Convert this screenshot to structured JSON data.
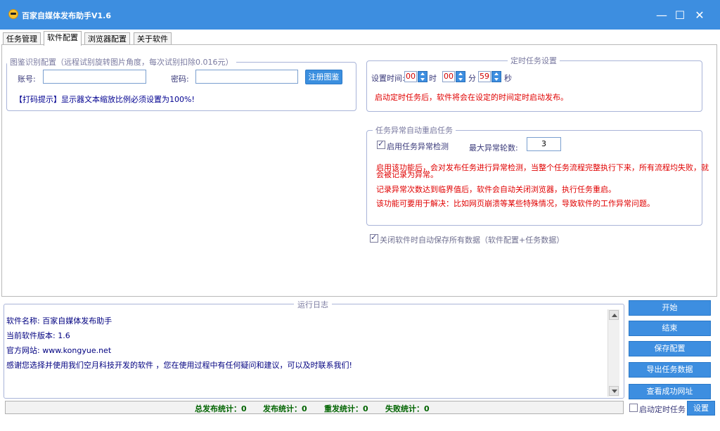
{
  "window": {
    "title": "百家自媒体发布助手V1.6",
    "minimize_icon": "minimize-icon",
    "maximize_icon": "maximize-icon",
    "close_icon": "close-icon",
    "minimize_glyph": "—",
    "maximize_glyph": "☐",
    "close_glyph": "✕"
  },
  "tabs": [
    {
      "label": "任务管理",
      "active": false
    },
    {
      "label": "软件配置",
      "active": true
    },
    {
      "label": "浏览器配置",
      "active": false
    },
    {
      "label": "关于软件",
      "active": false
    }
  ],
  "captcha": {
    "legend": "图鉴识别配置（远程试别旋转图片角度，每次试别扣除0.016元）",
    "account_label": "账号:",
    "account_value": "",
    "password_label": "密码:",
    "password_value": "",
    "register_button": "注册图鉴",
    "tip": "【打码提示】显示器文本缩放比例必须设置为100%!"
  },
  "schedule": {
    "legend": "定时任务设置",
    "time_label": "设置时间:",
    "hour": "00",
    "hour_unit": "时",
    "minute": "00",
    "minute_unit": "分",
    "second": "59",
    "second_unit": "秒",
    "note": "启动定时任务后，软件将会在设定的时间定时启动发布。"
  },
  "restart": {
    "legend": "任务异常自动重启任务",
    "enable_label": "启用任务异常检测",
    "enable_checked": true,
    "max_label": "最大异常轮数:",
    "max_value": "3",
    "note1a": "启用该功能后，会对发布任务进行异常检测，当整个任务流程完整执行下来，所有流程均失败，就",
    "note1b": "会被记录为异常。",
    "note2": "记录异常次数达到临界值后，软件会自动关闭浏览器，执行任务重启。",
    "note3": "该功能可要用于解决：比如网页崩溃等某些特殊情况，导致软件的工作异常问题。"
  },
  "autosave": {
    "label": "关闭软件时自动保存所有数据（软件配置+任务数据）",
    "checked": true
  },
  "log": {
    "title": "运行日志",
    "lines": [
      "软件名称: 百家自媒体发布助手",
      "当前软件版本: 1.6",
      "官方网站: www.kongyue.net",
      "感谢您选择并使用我们空月科技开发的软件 ，您在使用过程中有任何疑问和建议，可以及时联系我们!"
    ]
  },
  "stats": {
    "total": "总发布统计：0",
    "publish": "发布统计：0",
    "repost": "重发统计：0",
    "fail": "失败统计：0"
  },
  "actions": {
    "start": "开始",
    "stop": "结束",
    "save": "保存配置",
    "export": "导出任务数据",
    "view": "查看成功网址",
    "timer_label": "启动定时任务",
    "timer_checked": false,
    "settings": "设置"
  },
  "colors": {
    "titlebar": "#3d8ee0",
    "button": "#3d8ee0",
    "warning": "#e00000",
    "stats": "#006400"
  }
}
